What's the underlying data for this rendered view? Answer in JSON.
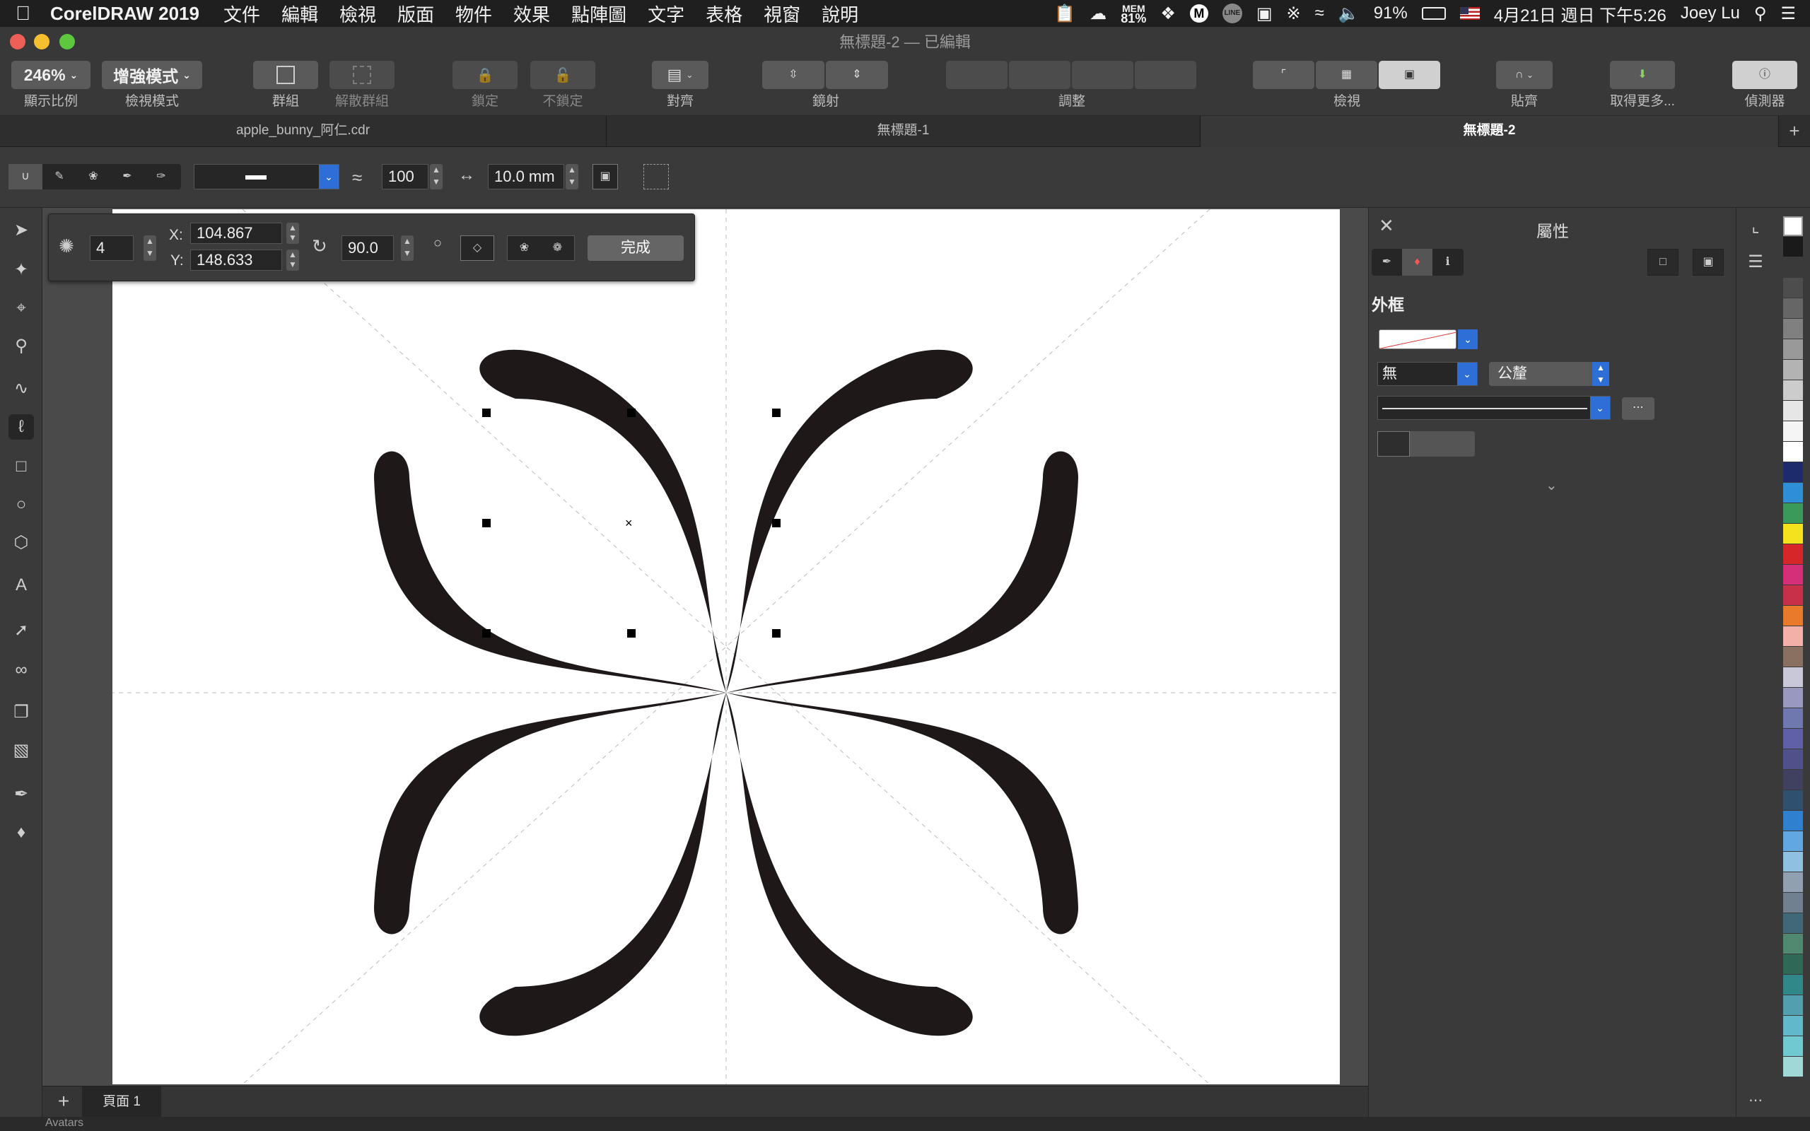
{
  "menubar": {
    "app_name": "CorelDRAW 2019",
    "items": [
      "文件",
      "編輯",
      "檢視",
      "版面",
      "物件",
      "效果",
      "點陣圖",
      "文字",
      "表格",
      "視窗",
      "說明"
    ],
    "mem_label": "MEM",
    "mem_value": "81%",
    "battery": "91%",
    "datetime": "4月21日 週日 下午5:26",
    "user": "Joey Lu"
  },
  "window": {
    "title": "無標題-2 — 已編輯"
  },
  "toolbar": {
    "zoom_value": "246%",
    "zoom_label": "顯示比例",
    "view_mode_value": "增強模式",
    "view_mode_label": "檢視模式",
    "group_label": "群組",
    "ungroup_label": "解散群組",
    "lock_label": "鎖定",
    "unlock_label": "不鎖定",
    "align_label": "對齊",
    "mirror_label": "鏡射",
    "arrange_label": "調整",
    "view_label": "檢視",
    "snap_label": "貼齊",
    "get_more_label": "取得更多...",
    "hints_label": "偵測器"
  },
  "tabs": [
    {
      "label": "apple_bunny_阿仁.cdr",
      "active": false
    },
    {
      "label": "無標題-1",
      "active": false
    },
    {
      "label": "無標題-2",
      "active": true
    }
  ],
  "propbar": {
    "smoothing_value": "100",
    "nib_size_value": "10.0 mm"
  },
  "floatbar": {
    "copies_value": "4",
    "x_label": "X:",
    "x_value": "104.867",
    "y_label": "Y:",
    "y_value": "148.633",
    "angle_value": "90.0",
    "done_label": "完成"
  },
  "bottombar": {
    "page_label": "頁面 1",
    "status_text": "Avatars"
  },
  "inspector": {
    "title": "屬性",
    "section_title": "外框",
    "width_value": "無",
    "unit_value": "公釐"
  },
  "palette_colors": [
    "#ffffff",
    "#1a1a1a",
    "#3a3a3a",
    "#4d4d4d",
    "#666666",
    "#808080",
    "#999999",
    "#b3b3b3",
    "#cccccc",
    "#e6e6e6",
    "#f5f5f5",
    "#ffffff",
    "#1d2a6b",
    "#2f8fd6",
    "#3a9a5a",
    "#f3e21c",
    "#d6262a",
    "#d62f7a",
    "#c8304a",
    "#e87a2a",
    "#f2b0a8",
    "#8a7060",
    "#c8c8d8",
    "#9898c0",
    "#7078b0",
    "#6060a8",
    "#50508a",
    "#404060",
    "#305070",
    "#3080d0",
    "#60a8e0",
    "#90c0e0",
    "#90a0b0",
    "#708090",
    "#406878",
    "#508870",
    "#306858",
    "#308888",
    "#50a0b0",
    "#60b8c8",
    "#70c8d0",
    "#a0d8d8"
  ]
}
